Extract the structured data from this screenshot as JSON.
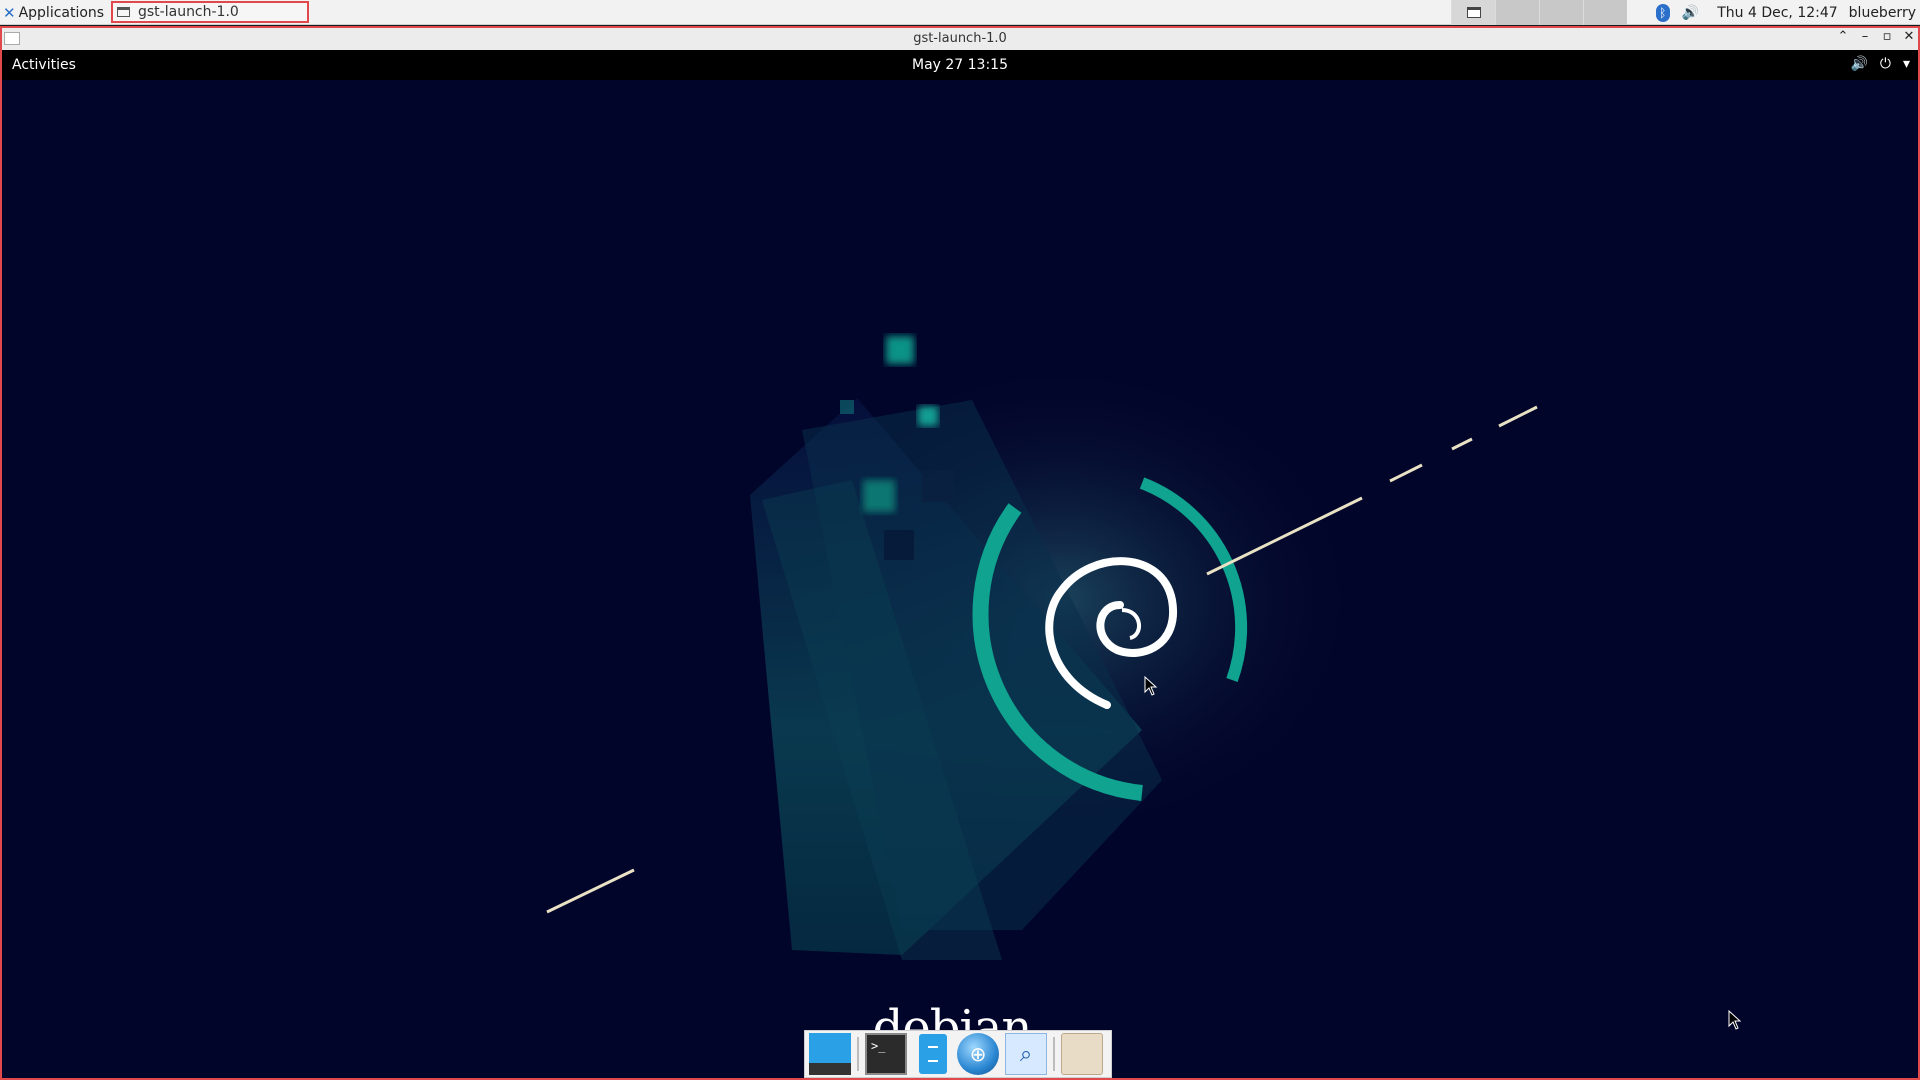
{
  "host_panel": {
    "applications_label": "Applications",
    "taskbar_item": "gst-launch-1.0",
    "clock": "Thu  4 Dec, 12:47",
    "user": "blueberry"
  },
  "window": {
    "title": "gst-launch-1.0"
  },
  "guest": {
    "activities": "Activities",
    "clock": "May 27  13:15",
    "logo_text": "debian"
  },
  "dock": {
    "items": [
      "show-desktop",
      "terminal",
      "files",
      "web-browser",
      "search",
      "file-manager"
    ]
  },
  "colors": {
    "accent_teal": "#0fa390",
    "wallpaper_bg": "#02052a",
    "highlight_red": "#e0484c",
    "debian_red": "#d70751"
  }
}
